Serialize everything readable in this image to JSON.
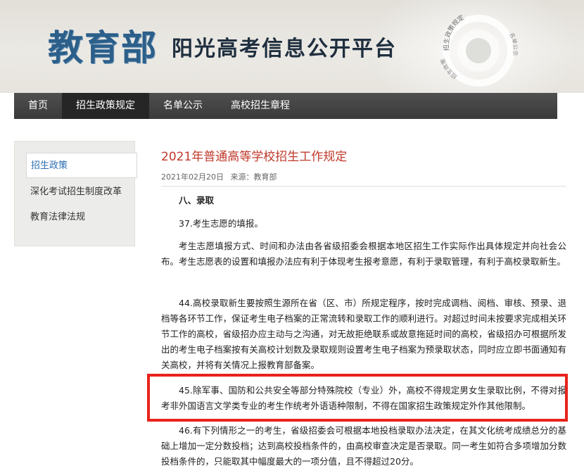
{
  "header": {
    "logo_main": "教育部",
    "logo_sub": "阳光高考信息公开平台",
    "seal_text_top": "招生政策规定",
    "seal_text_left": "招生政策",
    "seal_text_right": "名单公示"
  },
  "nav": {
    "items": [
      "首页",
      "招生政策规定",
      "名单公示",
      "高校招生章程"
    ],
    "active_index": 1
  },
  "sidebar": {
    "items": [
      "招生政策",
      "深化考试招生制度改革",
      "教育法律法规"
    ],
    "active_index": 0
  },
  "article": {
    "title": "2021年普通高等学校招生工作规定",
    "date": "2021年02月20日",
    "source": "来源：教育部",
    "paragraphs": [
      "八、录取",
      "37.考生志愿的填报。",
      "考生志愿填报方式、时间和办法由各省级招委会根据本地区招生工作实际作出具体规定并向社会公布。考生志愿表的设置和填报办法应有利于体现考生报考意愿，有利于录取管理，有利于高校录取新生。",
      "44.高校录取新生要按照生源所在省（区、市）所规定程序，按时完成调档、阅档、审核、预录、退档等各环节工作，保证考生电子档案的正常流转和录取工作的顺利进行。对超过时间未按要求完成相关环节工作的高校，省级招办应主动与之沟通，对无故拒绝联系或故意拖延时间的高校，省级招办可根据所发出的考生电子档案按有关高校计划数及录取规则设置考生电子档案为预录取状态，同时应立即书面通知有关高校，并将有关情况上报教育部备案。",
      "45.除军事、国防和公共安全等部分特殊院校（专业）外，高校不得规定男女生录取比例，不得对报考非外国语言文学类专业的考生作统考外语语种限制，不得在国家招生政策规定外作其他限制。",
      "46.有下列情形之一的考生，省级招委会可根据本地投档录取办法决定，在其文化统考成绩总分的基础上增加一定分数投档；达到高校投档条件的，由高校审查决定是否录取。同一考生如符合多项增加分数投档条件的，只能取其中幅度最大的一项分值，且不得超过20分。"
    ]
  },
  "colors": {
    "nav_bg": "#3f3f3f",
    "title_red": "#c0392b",
    "sidebar_active": "#2d6eb2",
    "highlight_border": "#e8231c",
    "logo_blue": "#2c5f8a"
  }
}
